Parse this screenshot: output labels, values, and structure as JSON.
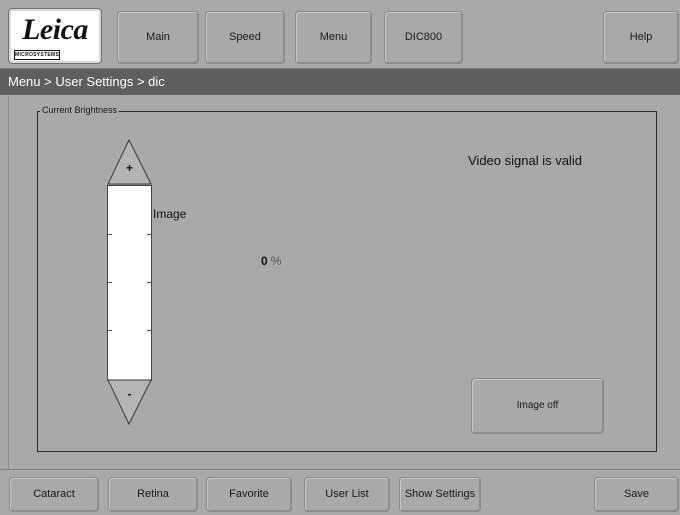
{
  "logo": {
    "wordmark": "Leica",
    "subtitle": "MICROSYSTEMS"
  },
  "topnav": {
    "main": "Main",
    "speed": "Speed",
    "menu": "Menu",
    "dic800": "DIC800",
    "help": "Help"
  },
  "breadcrumb": "Menu > User Settings > dic",
  "brightness": {
    "group_label": "Current Brightness",
    "plus_label": "+",
    "minus_label": "-",
    "slider_label": "Image",
    "value": "0",
    "unit": "%",
    "level_fraction": 0
  },
  "signal_status": "Video signal is valid",
  "image_off_label": "Image off",
  "bottomnav": {
    "cataract": "Cataract",
    "retina": "Retina",
    "favorite": "Favorite",
    "user_list": "User List",
    "show_settings": "Show Settings",
    "save": "Save"
  },
  "colors": {
    "background": "#a9a9a9",
    "breadcrumb_bar": "#5e5e5e",
    "slider_track": "#ffffff"
  }
}
